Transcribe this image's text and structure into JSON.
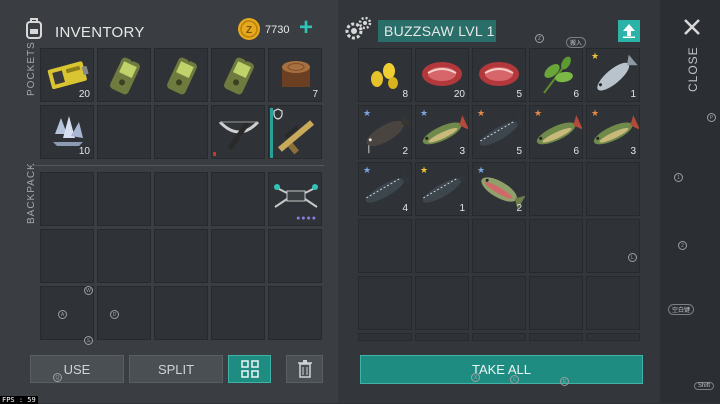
{
  "inventory": {
    "title": "INVENTORY",
    "coins": "7730",
    "add_symbol": "+",
    "pockets_label": "POCKETS",
    "backpack_label": "BACKPACK",
    "pocket_counts": [
      "20",
      "",
      "",
      "",
      "7",
      "10",
      "",
      "",
      "",
      ""
    ]
  },
  "container": {
    "title": "BUZZSAW LVL 1",
    "counts": [
      "8",
      "20",
      "5",
      "6",
      "1",
      "2",
      "3",
      "5",
      "6",
      "3",
      "4",
      "1",
      "2"
    ]
  },
  "close_label": "CLOSE",
  "buttons": {
    "use": "USE",
    "split": "SPLIT",
    "take_all": "TAKE ALL"
  },
  "fps": "FPS : 59",
  "hints": {
    "top": "搬入",
    "right1": "空白键",
    "right2": "Shift"
  },
  "colors": {
    "accent": "#1f8c82",
    "coin": "#e6a91e",
    "teal_plus": "#2ec4b6"
  }
}
